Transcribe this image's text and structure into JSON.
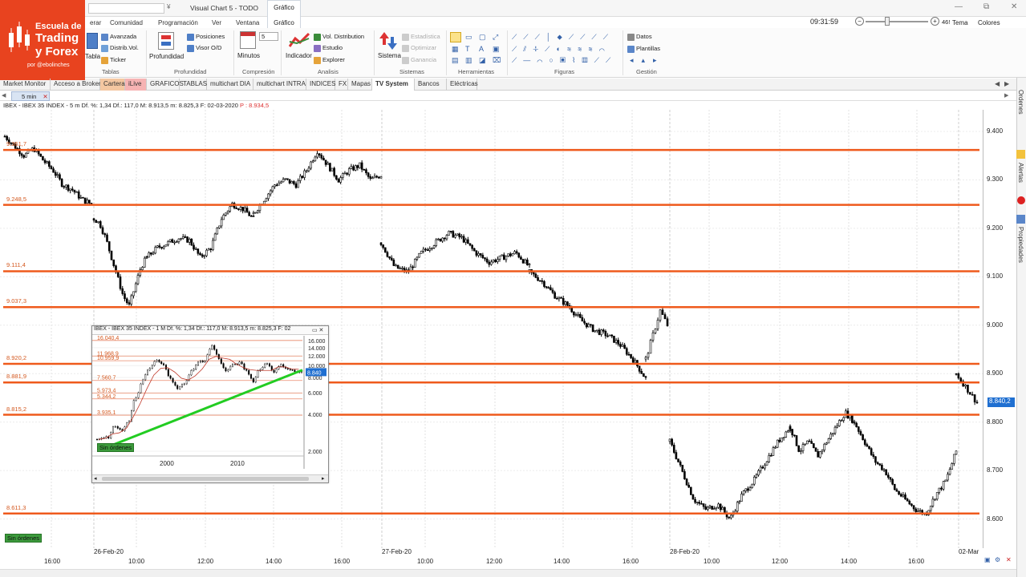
{
  "window": {
    "title": "Visual Chart 5 - TODO",
    "qat_arrow": "¥",
    "minimize": "—",
    "restore": "⧉",
    "close": "✕"
  },
  "brand": {
    "line1": "Escuela de",
    "line2": "Trading",
    "line3": "y Forex",
    "line4": "por @ebolinches"
  },
  "menu": {
    "items": [
      "erar",
      "Comunidad",
      "Programación",
      "Ver",
      "Ventana",
      "Gráfico"
    ],
    "active_tab_top": "Gráfico"
  },
  "top_right": {
    "clock": "09:31:59",
    "zoom_minus": "−",
    "zoom_plus": "+",
    "zoom_value": "46!",
    "tema": "Tema",
    "colores": "Colores"
  },
  "ribbon": {
    "tablas_group": "Tablas",
    "tablas_big": "Tabla",
    "avanzada": "Avanzada",
    "distrib": "Distrib.Vol.",
    "ticker": "Ticker",
    "profundidad_big": "Profundidad",
    "posiciones": "Posiciones",
    "visor": "Visor O/D",
    "profundidad_group": "Profundidad",
    "minutos_big": "Minutos",
    "minutos_value": "5",
    "compresion_group": "Compresión",
    "indicador_big": "Indicador",
    "vol_dist": "Vol. Distribution",
    "estudio": "Estudio",
    "explorer": "Explorer",
    "analisis_group": "Analisis",
    "sistema_big": "Sistema",
    "estadistica": "Estadística",
    "optimizar": "Optimizar",
    "ganancia": "Ganancia",
    "sistemas_group": "Sistemas",
    "herramientas_group": "Herramientas",
    "figuras_group": "Figuras",
    "datos": "Datos",
    "plantillas": "Plantillas",
    "gestion_group": "Gestión"
  },
  "page_tabs": [
    "Market Monitor",
    "Acceso a Broker",
    "Cartera",
    "iLive",
    "GRAFICOS",
    "TABLAS",
    "multichart DIA",
    "multichart INTRA",
    "INDICES",
    "FX",
    "Mapas",
    "TV System",
    "Bancos",
    "Eléctricas"
  ],
  "active_page_tab": "TV System",
  "subtab": {
    "label": "5 min",
    "close": "✕"
  },
  "chart": {
    "header": "IBEX - IBEX 35 INDEX - 5 m  Df. %: 1,34  Df.: 117,0  M: 8.913,5  m: 8.825,3  F: 02-03-2020",
    "header_p": "P : 8.934,5",
    "yticks": [
      "9.400",
      "9.300",
      "9.200",
      "9.100",
      "9.000",
      "8.900",
      "8.800",
      "8.700",
      "8.600"
    ],
    "last_price": "8.840,2",
    "levels": [
      "9.361,7",
      "9.248,5",
      "9.111,4",
      "9.037,3",
      "8.920,2",
      "8.881,9",
      "8.815,2",
      "8.611,3"
    ],
    "xticks": [
      "16:00",
      "26-Feb-20",
      "10:00",
      "12:00",
      "14:00",
      "16:00",
      "27-Feb-20",
      "10:00",
      "12:00",
      "14:00",
      "16:00",
      "28-Feb-20",
      "10:00",
      "12:00",
      "14:00",
      "16:00",
      "02-Mar"
    ],
    "status_badge": "Sin órdenes"
  },
  "inset": {
    "header": "IBEX - IBEX 35 INDEX - 1 M  Df. %: 1,34  Df.: 117,0  M: 8.913,5  m: 8.825,3  F: 02",
    "yticks": [
      "16.000",
      "14.000",
      "12.000",
      "10.000",
      "8.000",
      "6.000",
      "4.000",
      "2.000"
    ],
    "levels": [
      "16.040,4",
      "11.968,9",
      "10.959,9",
      "7.560,7",
      "5.973,4",
      "5.344,2",
      "3.935,1"
    ],
    "last_price": "8.840",
    "xticks": [
      "2000",
      "2010"
    ],
    "status_badge": "Sin órdenes"
  },
  "right_panel": {
    "ordenes": "Ordenes",
    "alertas": "Alertas",
    "propiedades": "Propiedades"
  },
  "colors": {
    "accent": "#e8431f",
    "level_line": "#ef5a1c",
    "up_candle": "#ffffff",
    "down_candle": "#000000",
    "trend": "#22cc22"
  }
}
